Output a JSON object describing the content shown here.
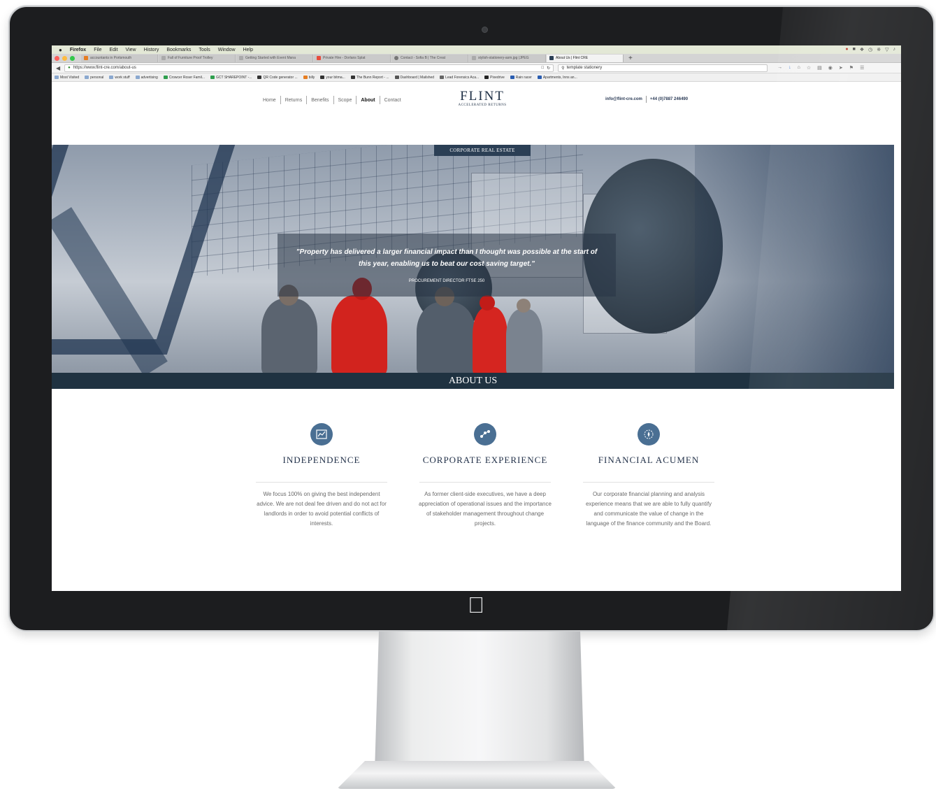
{
  "menubar": {
    "apple": "",
    "items": [
      "Firefox",
      "File",
      "Edit",
      "View",
      "History",
      "Bookmarks",
      "Tools",
      "Window",
      "Help"
    ]
  },
  "tabs": [
    {
      "label": "accountants in Portsmouth",
      "active": false
    },
    {
      "label": "Fall of Furniture Proof Trolley",
      "active": false
    },
    {
      "label": "Getting Started with Event Mana",
      "active": false
    },
    {
      "label": "Private Hire - Dorlans Splat",
      "active": false
    },
    {
      "label": "Contact - Sofia B | The Creat",
      "active": false
    },
    {
      "label": "stylish-stationery-asm.jpg (JPEG",
      "active": false
    },
    {
      "label": "About Us | Flint CRE",
      "active": true
    }
  ],
  "navbar": {
    "url": "https://www.flint-cre.com/about-us",
    "search": "template stationery"
  },
  "bookmarks": [
    "Most Visited",
    "personal",
    "work stuff",
    "advertising",
    "Crowcer Roser Famil...",
    "GCT SHAREPOINT -...",
    "QR Code generator ...",
    "billy",
    "your bitma...",
    "The Bunn Report - ...",
    "Dashboard | Mailshed",
    "Lead Forensics Aca...",
    "Pixedrive",
    "Rain racer",
    "Apartments, Inns an..."
  ],
  "site": {
    "nav": [
      "Home",
      "Returns",
      "Benefits",
      "Scope",
      "About",
      "Contact"
    ],
    "active_nav": "About",
    "logo_title": "FLINT",
    "logo_tagline": "ACCELERATED RETURNS",
    "email": "info@flint-cre.com",
    "phone": "+44 (0)7887 246490"
  },
  "hero": {
    "badge": "CORPORATE REAL ESTATE",
    "quote": "\"Property has delivered a larger financial impact than I thought was possible at the start of this year, enabling us to beat our cost saving target.\"",
    "author": "PROCUREMENT DIRECTOR FTSE 250"
  },
  "about": {
    "heading": "ABOUT US",
    "features": [
      {
        "icon": "chart-icon",
        "title": "INDEPENDENCE",
        "desc": "We focus 100% on giving the best independent advice. We are not deal fee driven and do not act for landlords in order to avoid potential conflicts of interests."
      },
      {
        "icon": "network-icon",
        "title": "CORPORATE EXPERIENCE",
        "desc": "As former client-side executives, we have a deep appreciation of operational issues and the importance of stakeholder management throughout change projects."
      },
      {
        "icon": "compass-icon",
        "title": "FINANCIAL ACUMEN",
        "desc": "Our corporate financial planning and analysis experience means that we are able to fully quantify and communicate the value of change in the language of the finance community and the Board."
      }
    ]
  },
  "colors": {
    "brand_navy": "#1f3241",
    "icon_blue": "#4a6f93",
    "text_navy": "#23324a"
  }
}
